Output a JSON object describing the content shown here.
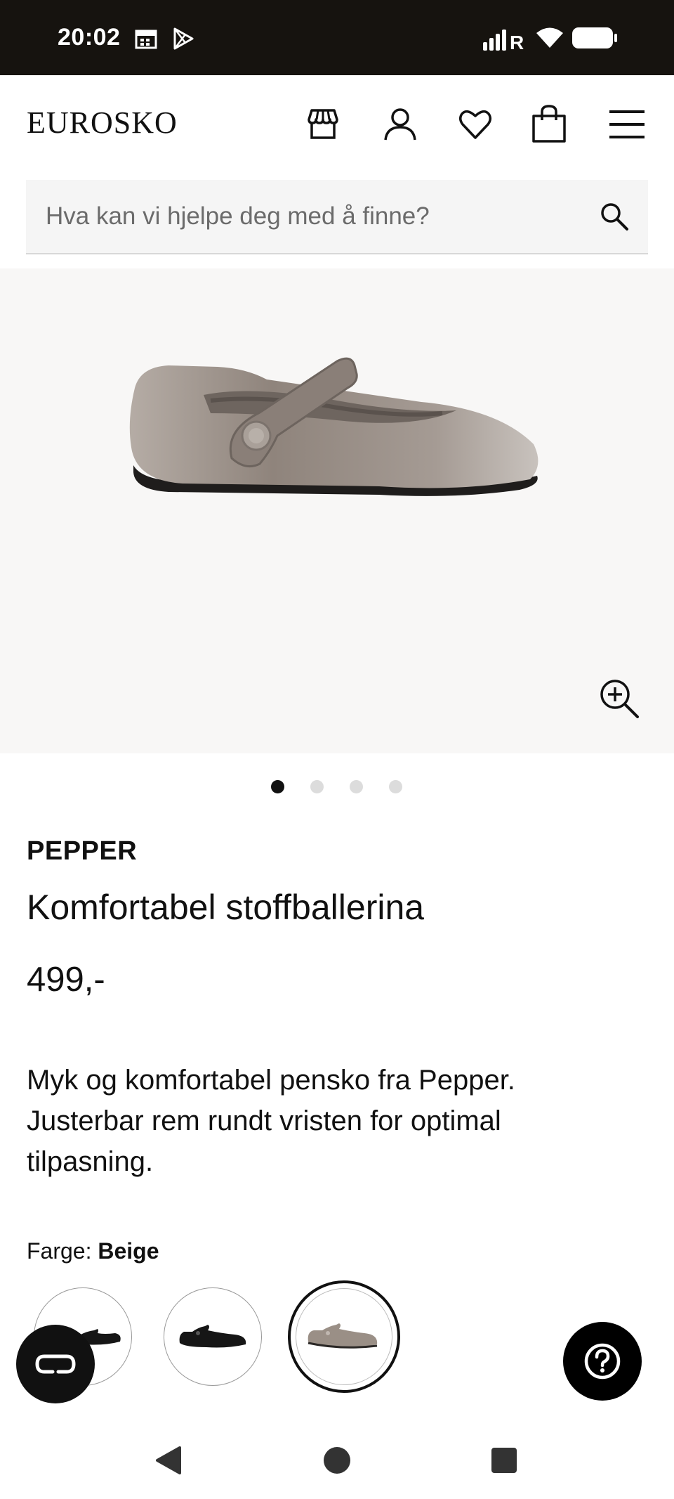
{
  "status_bar": {
    "time": "20:02",
    "icons": [
      "calendar-icon",
      "play-store-icon",
      "signal-icon",
      "wifi-icon",
      "battery-icon"
    ]
  },
  "header": {
    "logo": "EUROSKO",
    "icons": [
      "store-icon",
      "account-icon",
      "heart-icon",
      "bag-icon",
      "menu-icon"
    ]
  },
  "search": {
    "placeholder": "Hva kan vi hjelpe deg med å finne?"
  },
  "gallery": {
    "image_count": 4,
    "active_index": 0
  },
  "product": {
    "brand": "PEPPER",
    "title": "Komfortabel stoffballerina",
    "price": "499,-",
    "description": "Myk og komfortabel pensko fra Pepper. Justerbar rem rundt vristen for optimal tilpasning.",
    "color_label": "Farge:",
    "color_value": "Beige"
  },
  "colors": {
    "swatches": [
      "black",
      "black",
      "beige"
    ],
    "selected_index": 2,
    "shoe_beige": "#9a8f86",
    "shoe_black": "#161616"
  },
  "floating": {
    "chat_icon": "chat-icon",
    "help_icon": "help-icon"
  },
  "nav": {
    "icons": [
      "back-icon",
      "home-icon",
      "recents-icon"
    ]
  }
}
